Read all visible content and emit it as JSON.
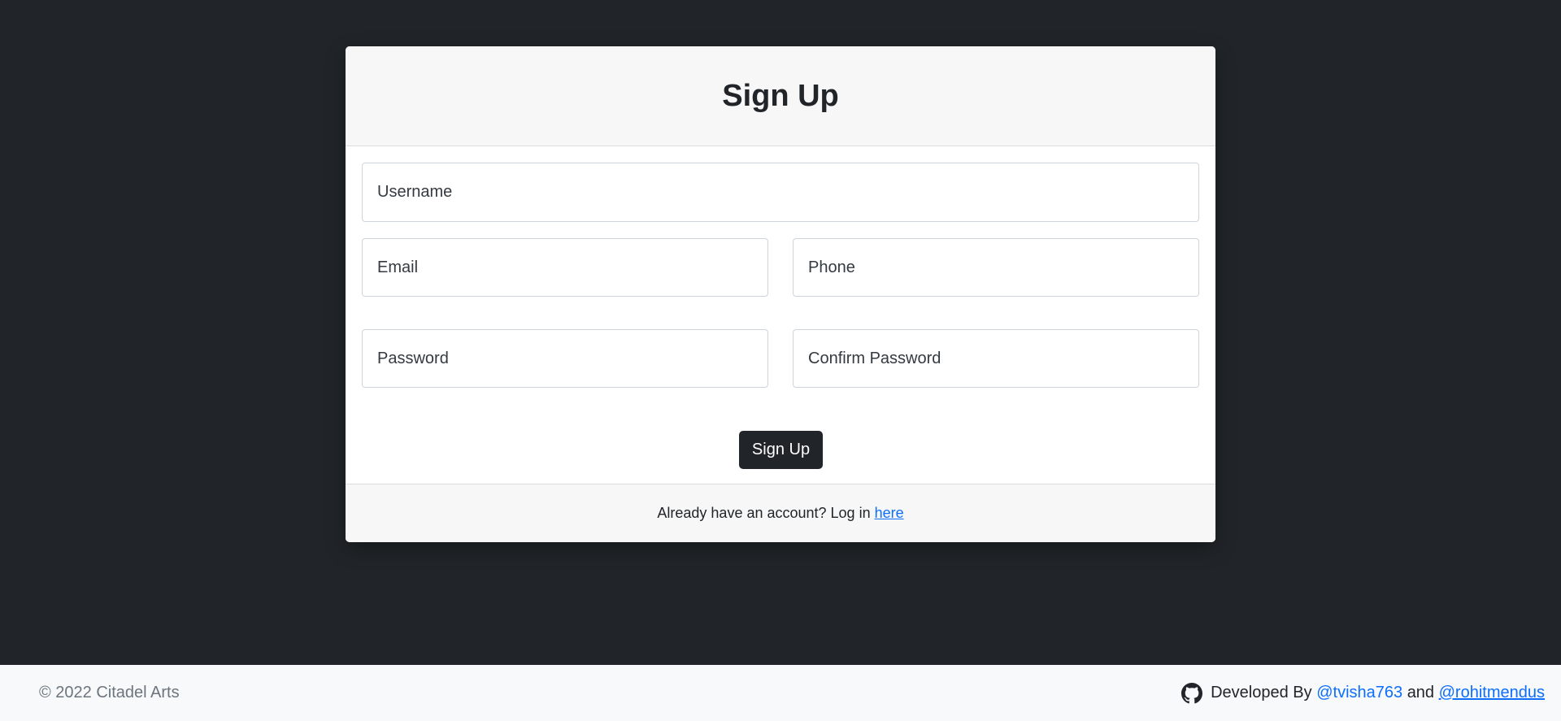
{
  "card": {
    "title": "Sign Up",
    "fields": {
      "username": {
        "placeholder": "Username",
        "value": ""
      },
      "email": {
        "placeholder": "Email",
        "value": ""
      },
      "phone": {
        "placeholder": "Phone",
        "value": ""
      },
      "password": {
        "placeholder": "Password",
        "value": ""
      },
      "confirm_password": {
        "placeholder": "Confirm Password",
        "value": ""
      }
    },
    "submit_label": "Sign Up",
    "footer": {
      "text": "Already have an account? Log in",
      "link_label": "here"
    }
  },
  "page_footer": {
    "copyright": "© 2022 Citadel Arts",
    "icon": "github-icon",
    "developed_by": "Developed By",
    "dev1": "@tvisha763",
    "and": "and",
    "dev2": "@rohitmendus"
  },
  "colors": {
    "page_bg": "#212529",
    "card_bg": "#ffffff",
    "header_bg": "#f7f7f7",
    "button_bg": "#212529",
    "link": "#0d6efd",
    "footer_bg": "#f8f9fa"
  }
}
